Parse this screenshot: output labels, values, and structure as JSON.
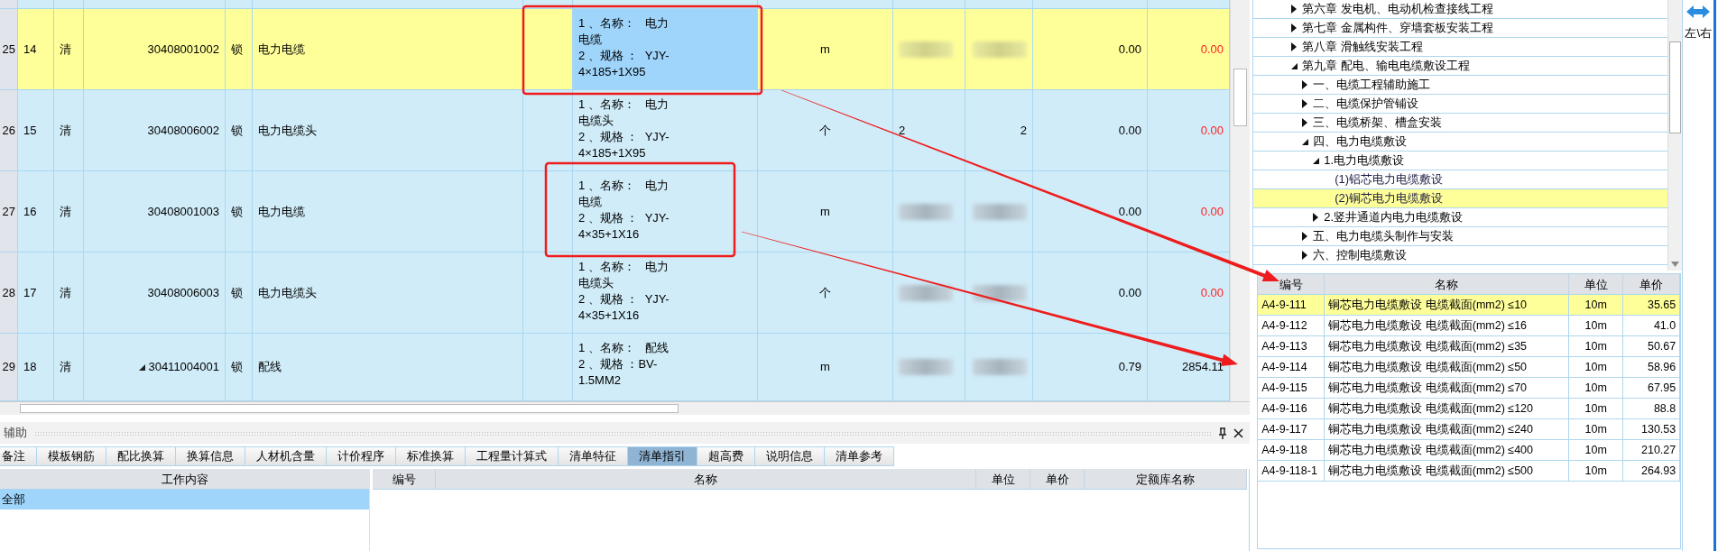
{
  "main_table": {
    "rows": [
      {
        "row_number": "25",
        "seq": "14",
        "type": "清",
        "code": "30408001002",
        "kind": "item",
        "lock": "锁",
        "name": "电力电缆",
        "description_lines": [
          "1 、名称：   电力",
          "电缆",
          "2 、规格 ：  YJY-",
          "4×185+1X95"
        ],
        "unit": "m",
        "redacted": true,
        "col_11": "0.00",
        "col_12": "0.00",
        "col_12_red": true,
        "selected": true
      },
      {
        "row_number": "26",
        "seq": "15",
        "type": "清",
        "code": "30408006002",
        "kind": "item",
        "lock": "锁",
        "name": "电力电缆头",
        "description_lines": [
          "1 、名称：   电力",
          "电缆头",
          "2 、规格 ：  YJY-",
          "4×185+1X95"
        ],
        "unit": "个",
        "redacted": false,
        "qty_1": "2",
        "qty_2": "2",
        "col_11": "0.00",
        "col_12": "0.00",
        "col_12_red": true,
        "selected": false
      },
      {
        "row_number": "27",
        "seq": "16",
        "type": "清",
        "code": "30408001003",
        "kind": "item",
        "lock": "锁",
        "name": "电力电缆",
        "description_lines": [
          "1 、名称：   电力",
          "电缆",
          "2 、规格 ：  YJY-",
          "4×35+1X16"
        ],
        "unit": "m",
        "redacted": true,
        "col_11": "0.00",
        "col_12": "0.00",
        "col_12_red": true,
        "selected": false
      },
      {
        "row_number": "28",
        "seq": "17",
        "type": "清",
        "code": "30408006003",
        "kind": "item",
        "lock": "锁",
        "name": "电力电缆头",
        "description_lines": [
          "1 、名称：   电力",
          "电缆头",
          "2 、规格 ：  YJY-",
          "4×35+1X16"
        ],
        "unit": "个",
        "redacted": true,
        "col_11": "0.00",
        "col_12": "0.00",
        "col_12_red": true,
        "selected": false
      },
      {
        "row_number": "29",
        "seq": "18",
        "type": "清",
        "code": "30411004001",
        "kind": "parent",
        "expanded": true,
        "lock": "锁",
        "name": "配线",
        "description_lines": [
          "1 、名称：   配线",
          "2 、规格 ：BV-",
          "1.5MM2"
        ],
        "unit": "m",
        "redacted": true,
        "col_11": "0.79",
        "col_12": "2854.11",
        "col_12_red": false,
        "selected": false
      }
    ]
  },
  "aux_panel": {
    "title": "辅助",
    "tabs": [
      {
        "label": "备注",
        "selected": false
      },
      {
        "label": "模板钢筋",
        "selected": false
      },
      {
        "label": "配比换算",
        "selected": false
      },
      {
        "label": "换算信息",
        "selected": false
      },
      {
        "label": "人材机含量",
        "selected": false
      },
      {
        "label": "计价程序",
        "selected": false
      },
      {
        "label": "标准换算",
        "selected": false
      },
      {
        "label": "工程量计算式",
        "selected": false
      },
      {
        "label": "清单特征",
        "selected": false
      },
      {
        "label": "清单指引",
        "selected": true
      },
      {
        "label": "超高费",
        "selected": false
      },
      {
        "label": "说明信息",
        "selected": false
      },
      {
        "label": "清单参考",
        "selected": false
      }
    ],
    "work_content": {
      "header": "工作内容",
      "items": [
        {
          "label": "全部",
          "selected": true
        }
      ]
    },
    "guide_table": {
      "columns": [
        "编号",
        "名称",
        "单位",
        "单价",
        "定额库名称"
      ]
    }
  },
  "quota_tree": {
    "items": [
      {
        "label": "第六章 发电机、电动机检查接线工程",
        "kind": "branch",
        "expanded": false,
        "selected": false
      },
      {
        "label": "第七章 金属构件、穿墙套板安装工程",
        "kind": "branch",
        "expanded": false,
        "selected": false
      },
      {
        "label": "第八章 滑触线安装工程",
        "kind": "branch",
        "expanded": false,
        "selected": false
      },
      {
        "label": "第九章 配电、输电电缆敷设工程",
        "kind": "branch",
        "expanded": true,
        "selected": false,
        "children": [
          {
            "label": "一、电缆工程辅助施工",
            "kind": "branch",
            "expanded": false,
            "selected": false
          },
          {
            "label": "二、电缆保护管铺设",
            "kind": "branch",
            "expanded": false,
            "selected": false
          },
          {
            "label": "三、电缆桥架、槽盒安装",
            "kind": "branch",
            "expanded": false,
            "selected": false
          },
          {
            "label": "四、电力电缆敷设",
            "kind": "branch",
            "expanded": true,
            "selected": false,
            "children": [
              {
                "label": "1.电力电缆敷设",
                "kind": "branch",
                "expanded": true,
                "selected": false,
                "children": [
                  {
                    "label": "(1)铝芯电力电缆敷设",
                    "kind": "leaf",
                    "selected": false
                  },
                  {
                    "label": "(2)铜芯电力电缆敷设",
                    "kind": "leaf",
                    "selected": true
                  }
                ]
              },
              {
                "label": "2.竖井通道内电力电缆敷设",
                "kind": "branch",
                "expanded": false,
                "selected": false
              }
            ]
          },
          {
            "label": "五、电力电缆头制作与安装",
            "kind": "branch",
            "expanded": false,
            "selected": false
          },
          {
            "label": "六、控制电缆敷设",
            "kind": "branch",
            "expanded": false,
            "selected": false
          }
        ]
      }
    ]
  },
  "side_button": {
    "label": "左\\右"
  },
  "quota_table": {
    "columns": [
      "编号",
      "名称",
      "单位",
      "单价"
    ],
    "rows": [
      {
        "code": "A4-9-111",
        "name": "铜芯电力电缆敷设 电缆截面(mm2) ≤10",
        "unit": "10m",
        "price": "35.65",
        "selected": true
      },
      {
        "code": "A4-9-112",
        "name": "铜芯电力电缆敷设 电缆截面(mm2) ≤16",
        "unit": "10m",
        "price": "41.0",
        "selected": false
      },
      {
        "code": "A4-9-113",
        "name": "铜芯电力电缆敷设 电缆截面(mm2) ≤35",
        "unit": "10m",
        "price": "50.67",
        "selected": false
      },
      {
        "code": "A4-9-114",
        "name": "铜芯电力电缆敷设 电缆截面(mm2) ≤50",
        "unit": "10m",
        "price": "58.96",
        "selected": false
      },
      {
        "code": "A4-9-115",
        "name": "铜芯电力电缆敷设 电缆截面(mm2) ≤70",
        "unit": "10m",
        "price": "67.95",
        "selected": false
      },
      {
        "code": "A4-9-116",
        "name": "铜芯电力电缆敷设 电缆截面(mm2) ≤120",
        "unit": "10m",
        "price": "88.8",
        "selected": false
      },
      {
        "code": "A4-9-117",
        "name": "铜芯电力电缆敷设 电缆截面(mm2) ≤240",
        "unit": "10m",
        "price": "130.53",
        "selected": false
      },
      {
        "code": "A4-9-118",
        "name": "铜芯电力电缆敷设 电缆截面(mm2) ≤400",
        "unit": "10m",
        "price": "210.27",
        "selected": false
      },
      {
        "code": "A4-9-118-1",
        "name": "铜芯电力电缆敷设 电缆截面(mm2) ≤500",
        "unit": "10m",
        "price": "264.93",
        "selected": false
      }
    ]
  },
  "annotations": [
    {
      "kind": "box"
    },
    {
      "kind": "box"
    },
    {
      "kind": "arrow"
    },
    {
      "kind": "arrow"
    }
  ]
}
